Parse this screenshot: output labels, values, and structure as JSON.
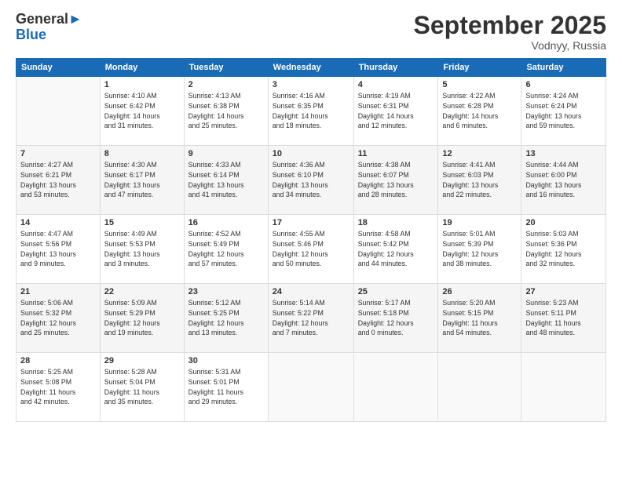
{
  "header": {
    "logo_line1": "General",
    "logo_line2": "Blue",
    "month": "September 2025",
    "location": "Vodnyy, Russia"
  },
  "days_of_week": [
    "Sunday",
    "Monday",
    "Tuesday",
    "Wednesday",
    "Thursday",
    "Friday",
    "Saturday"
  ],
  "weeks": [
    [
      {
        "day": "",
        "info": ""
      },
      {
        "day": "1",
        "info": "Sunrise: 4:10 AM\nSunset: 6:42 PM\nDaylight: 14 hours\nand 31 minutes."
      },
      {
        "day": "2",
        "info": "Sunrise: 4:13 AM\nSunset: 6:38 PM\nDaylight: 14 hours\nand 25 minutes."
      },
      {
        "day": "3",
        "info": "Sunrise: 4:16 AM\nSunset: 6:35 PM\nDaylight: 14 hours\nand 18 minutes."
      },
      {
        "day": "4",
        "info": "Sunrise: 4:19 AM\nSunset: 6:31 PM\nDaylight: 14 hours\nand 12 minutes."
      },
      {
        "day": "5",
        "info": "Sunrise: 4:22 AM\nSunset: 6:28 PM\nDaylight: 14 hours\nand 6 minutes."
      },
      {
        "day": "6",
        "info": "Sunrise: 4:24 AM\nSunset: 6:24 PM\nDaylight: 13 hours\nand 59 minutes."
      }
    ],
    [
      {
        "day": "7",
        "info": "Sunrise: 4:27 AM\nSunset: 6:21 PM\nDaylight: 13 hours\nand 53 minutes."
      },
      {
        "day": "8",
        "info": "Sunrise: 4:30 AM\nSunset: 6:17 PM\nDaylight: 13 hours\nand 47 minutes."
      },
      {
        "day": "9",
        "info": "Sunrise: 4:33 AM\nSunset: 6:14 PM\nDaylight: 13 hours\nand 41 minutes."
      },
      {
        "day": "10",
        "info": "Sunrise: 4:36 AM\nSunset: 6:10 PM\nDaylight: 13 hours\nand 34 minutes."
      },
      {
        "day": "11",
        "info": "Sunrise: 4:38 AM\nSunset: 6:07 PM\nDaylight: 13 hours\nand 28 minutes."
      },
      {
        "day": "12",
        "info": "Sunrise: 4:41 AM\nSunset: 6:03 PM\nDaylight: 13 hours\nand 22 minutes."
      },
      {
        "day": "13",
        "info": "Sunrise: 4:44 AM\nSunset: 6:00 PM\nDaylight: 13 hours\nand 16 minutes."
      }
    ],
    [
      {
        "day": "14",
        "info": "Sunrise: 4:47 AM\nSunset: 5:56 PM\nDaylight: 13 hours\nand 9 minutes."
      },
      {
        "day": "15",
        "info": "Sunrise: 4:49 AM\nSunset: 5:53 PM\nDaylight: 13 hours\nand 3 minutes."
      },
      {
        "day": "16",
        "info": "Sunrise: 4:52 AM\nSunset: 5:49 PM\nDaylight: 12 hours\nand 57 minutes."
      },
      {
        "day": "17",
        "info": "Sunrise: 4:55 AM\nSunset: 5:46 PM\nDaylight: 12 hours\nand 50 minutes."
      },
      {
        "day": "18",
        "info": "Sunrise: 4:58 AM\nSunset: 5:42 PM\nDaylight: 12 hours\nand 44 minutes."
      },
      {
        "day": "19",
        "info": "Sunrise: 5:01 AM\nSunset: 5:39 PM\nDaylight: 12 hours\nand 38 minutes."
      },
      {
        "day": "20",
        "info": "Sunrise: 5:03 AM\nSunset: 5:36 PM\nDaylight: 12 hours\nand 32 minutes."
      }
    ],
    [
      {
        "day": "21",
        "info": "Sunrise: 5:06 AM\nSunset: 5:32 PM\nDaylight: 12 hours\nand 25 minutes."
      },
      {
        "day": "22",
        "info": "Sunrise: 5:09 AM\nSunset: 5:29 PM\nDaylight: 12 hours\nand 19 minutes."
      },
      {
        "day": "23",
        "info": "Sunrise: 5:12 AM\nSunset: 5:25 PM\nDaylight: 12 hours\nand 13 minutes."
      },
      {
        "day": "24",
        "info": "Sunrise: 5:14 AM\nSunset: 5:22 PM\nDaylight: 12 hours\nand 7 minutes."
      },
      {
        "day": "25",
        "info": "Sunrise: 5:17 AM\nSunset: 5:18 PM\nDaylight: 12 hours\nand 0 minutes."
      },
      {
        "day": "26",
        "info": "Sunrise: 5:20 AM\nSunset: 5:15 PM\nDaylight: 11 hours\nand 54 minutes."
      },
      {
        "day": "27",
        "info": "Sunrise: 5:23 AM\nSunset: 5:11 PM\nDaylight: 11 hours\nand 48 minutes."
      }
    ],
    [
      {
        "day": "28",
        "info": "Sunrise: 5:25 AM\nSunset: 5:08 PM\nDaylight: 11 hours\nand 42 minutes."
      },
      {
        "day": "29",
        "info": "Sunrise: 5:28 AM\nSunset: 5:04 PM\nDaylight: 11 hours\nand 35 minutes."
      },
      {
        "day": "30",
        "info": "Sunrise: 5:31 AM\nSunset: 5:01 PM\nDaylight: 11 hours\nand 29 minutes."
      },
      {
        "day": "",
        "info": ""
      },
      {
        "day": "",
        "info": ""
      },
      {
        "day": "",
        "info": ""
      },
      {
        "day": "",
        "info": ""
      }
    ]
  ]
}
